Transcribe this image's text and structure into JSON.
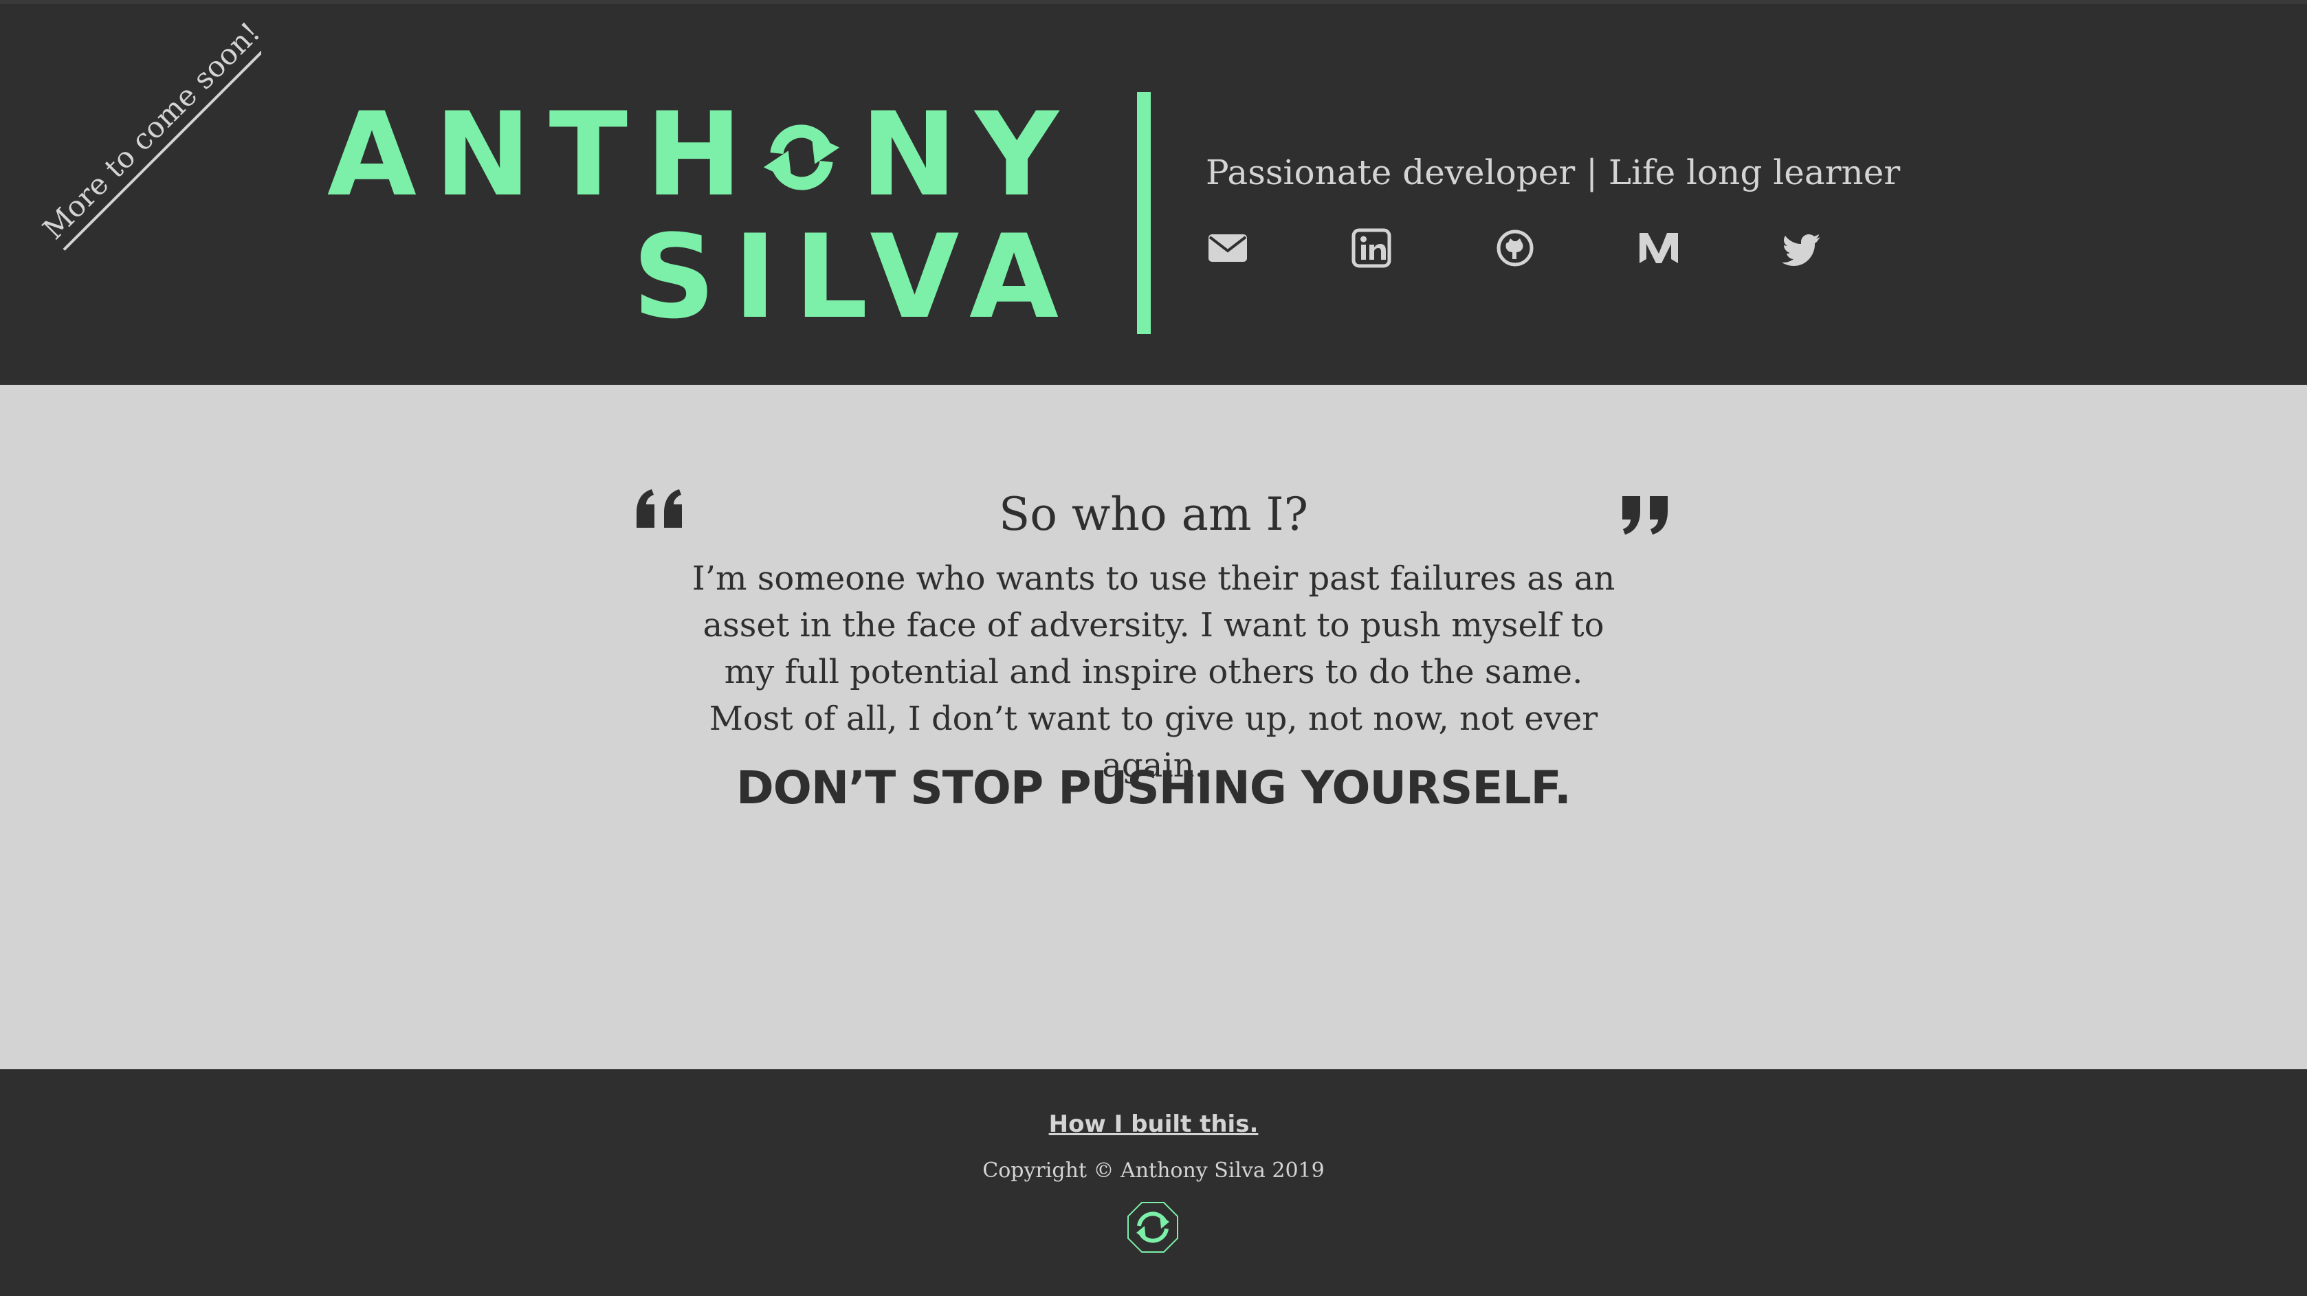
{
  "banner": {
    "text": "More to come soon!"
  },
  "header": {
    "name_line1_before": "ANTH",
    "name_line1_after": "NY",
    "name_line2": "SILVA",
    "tagline": "Passionate developer | Life long learner",
    "social": [
      {
        "icon": "envelope-icon"
      },
      {
        "icon": "linkedin-icon"
      },
      {
        "icon": "github-icon"
      },
      {
        "icon": "medium-icon"
      },
      {
        "icon": "twitter-icon"
      }
    ]
  },
  "about": {
    "heading": "So who am I?",
    "body": "I’m someone who wants to use their past failures as an asset in the face of adversity. I want to push myself to my full potential and inspire others to do the same. Most of all, I don’t want to give up, not now, not ever again.",
    "motto": "DON’T STOP PUSHING YOURSELF."
  },
  "footer": {
    "link": "How I built this.",
    "copyright": "Copyright © Anthony Silva 2019"
  },
  "colors": {
    "accent": "#7cf0a8",
    "dark": "#2f2f2f",
    "light": "#d3d3d3",
    "muted_text": "#d4d4d4"
  }
}
